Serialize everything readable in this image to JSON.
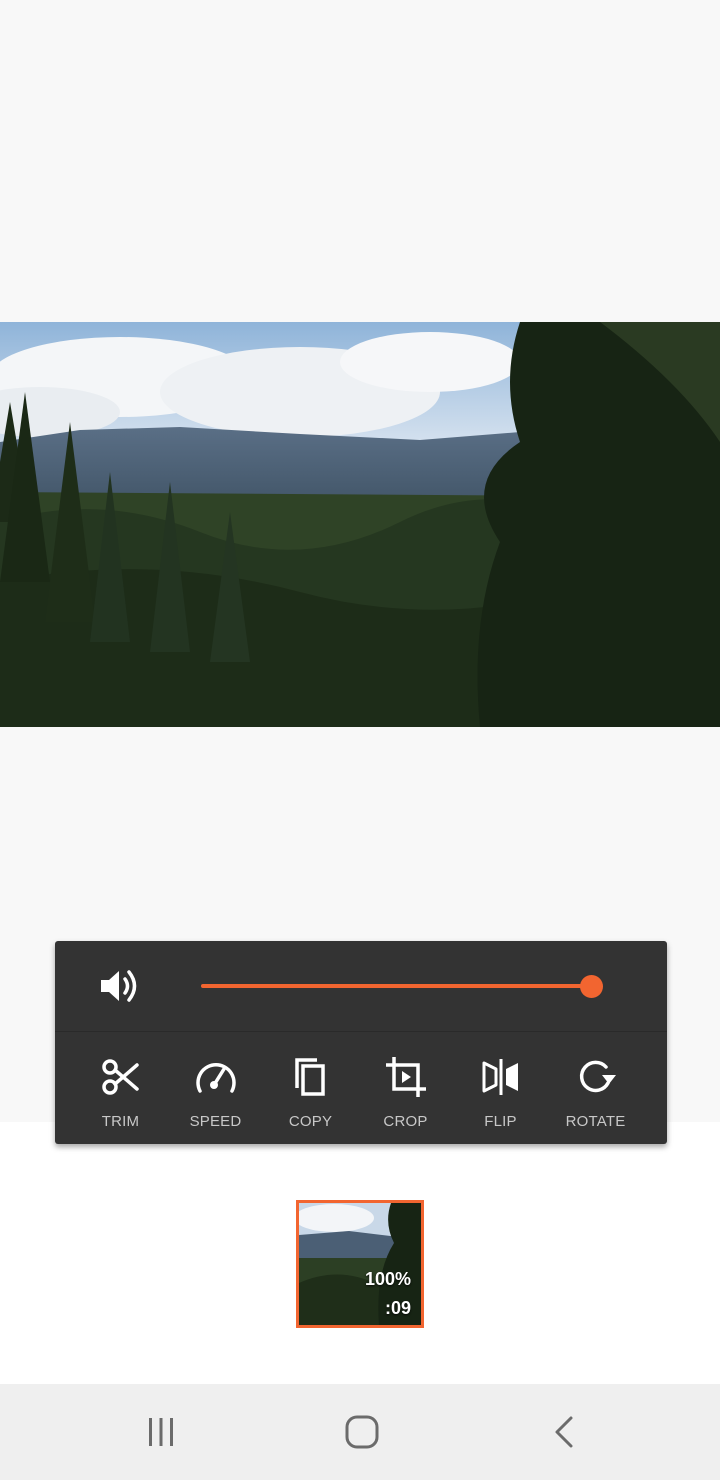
{
  "volume": {
    "level": 1.0,
    "icon": "volume-icon"
  },
  "tools": [
    {
      "label": "TRIM",
      "icon": "scissors-icon"
    },
    {
      "label": "SPEED",
      "icon": "speedometer-icon"
    },
    {
      "label": "COPY",
      "icon": "copy-icon"
    },
    {
      "label": "CROP",
      "icon": "crop-icon"
    },
    {
      "label": "FLIP",
      "icon": "flip-icon"
    },
    {
      "label": "ROTATE",
      "icon": "rotate-icon"
    }
  ],
  "clip": {
    "speed_label": "100%",
    "duration": ":09"
  },
  "colors": {
    "accent": "#f26530",
    "panel": "#333333",
    "label": "#c8c8c8"
  },
  "nav": {
    "recent": "recent-apps-icon",
    "home": "home-icon",
    "back": "back-icon"
  }
}
